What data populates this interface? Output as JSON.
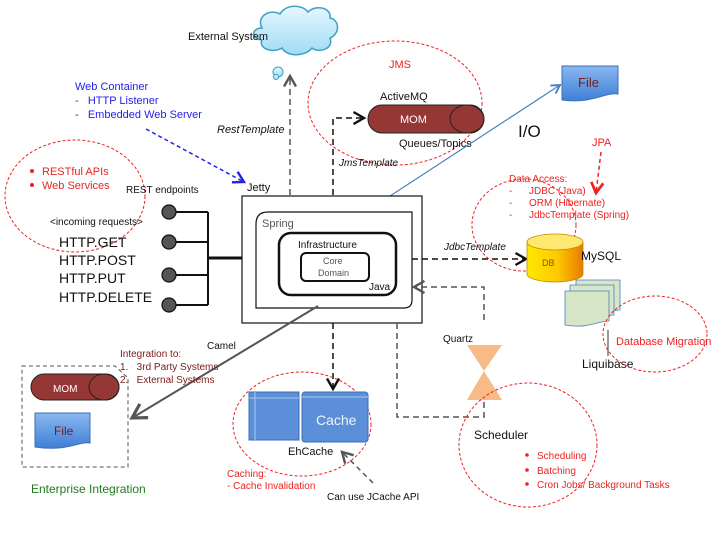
{
  "external_system": {
    "label": "External System"
  },
  "web_container": {
    "title": "Web Container",
    "items": [
      "-   HTTP Listener",
      "-   Embedded Web Server"
    ]
  },
  "rest_template": "RestTemplate",
  "jms": {
    "label": "JMS",
    "broker": "ActiveMQ",
    "mom": "MOM",
    "queues": "Queues/Topics",
    "template": "JmsTemplate"
  },
  "file_top": "File",
  "io_label": "I/O",
  "jpa": "JPA",
  "data_access": {
    "title": "Data Access:",
    "items": [
      "-      JDBC (Java)",
      "-      ORM (Hibernate)",
      "-      JdbcTemplate (Spring)"
    ]
  },
  "web_services": {
    "items": [
      "RESTful APIs",
      "Web Services"
    ]
  },
  "rest_endpoints": "REST endpoints",
  "incoming": "<incoming requests>",
  "http_methods": [
    "HTTP.GET",
    "HTTP.POST",
    "HTTP.PUT",
    "HTTP.DELETE"
  ],
  "jetty": "Jetty",
  "spring": "Spring",
  "infrastructure": "Infrastructure",
  "core_domain": [
    "Core",
    "Domain"
  ],
  "java": "Java",
  "jdbc_template": "JdbcTemplate",
  "db": {
    "label": "DB",
    "name": "MySQL"
  },
  "liquibase": {
    "label": "Liquibase",
    "note": "Database Migration"
  },
  "camel": "Camel",
  "integration": {
    "title": "Integration to:",
    "items": [
      "1.   3rd Party Systems",
      "2.   External Systems"
    ],
    "mom": "MOM",
    "file": "File",
    "caption": "Enterprise Integration"
  },
  "quartz": "Quartz",
  "cache": {
    "label": "Cache",
    "name": "EhCache",
    "caching_title": "Caching:",
    "caching_item": "- Cache Invalidation",
    "jcache": "Can use JCache API"
  },
  "scheduler": {
    "label": "Scheduler",
    "items": [
      "Scheduling",
      "Batching",
      "Cron Jobs/ Background Tasks"
    ]
  }
}
